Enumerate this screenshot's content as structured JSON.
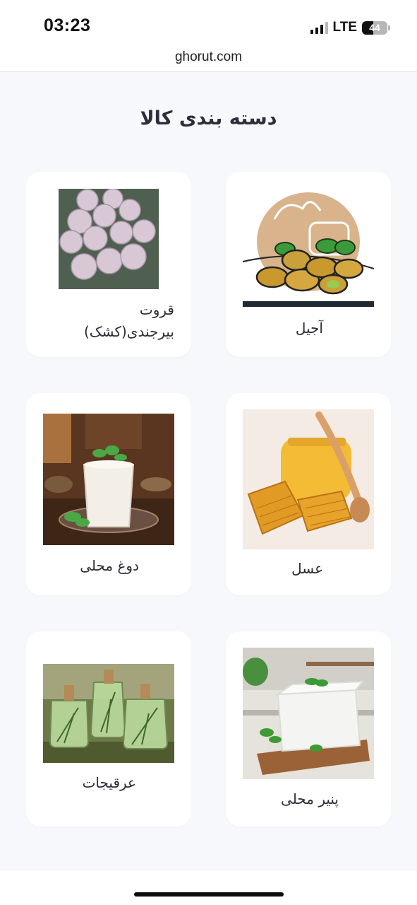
{
  "status_bar": {
    "time": "03:23",
    "network": "LTE",
    "battery": "44",
    "battery_level_percent": 44
  },
  "url_bar": {
    "domain": "ghorut.com"
  },
  "page": {
    "title": "دسته بندی کالا",
    "categories": [
      {
        "label": "آجیل",
        "image": "pistachio-illustration"
      },
      {
        "label_line1": "قروت",
        "label_line2": "بیرجندی(کشک)",
        "image": "qurut-balls-photo"
      },
      {
        "label": "عسل",
        "image": "honey-jar-photo"
      },
      {
        "label": "دوغ محلی",
        "image": "doogh-glass-photo"
      },
      {
        "label": "پنیر محلی",
        "image": "local-cheese-photo"
      },
      {
        "label": "عرقیجات",
        "image": "herbal-distillate-bottles-photo"
      }
    ]
  },
  "colors": {
    "background": "#f6f8fb",
    "card": "#ffffff",
    "text": "#2a2d36"
  }
}
